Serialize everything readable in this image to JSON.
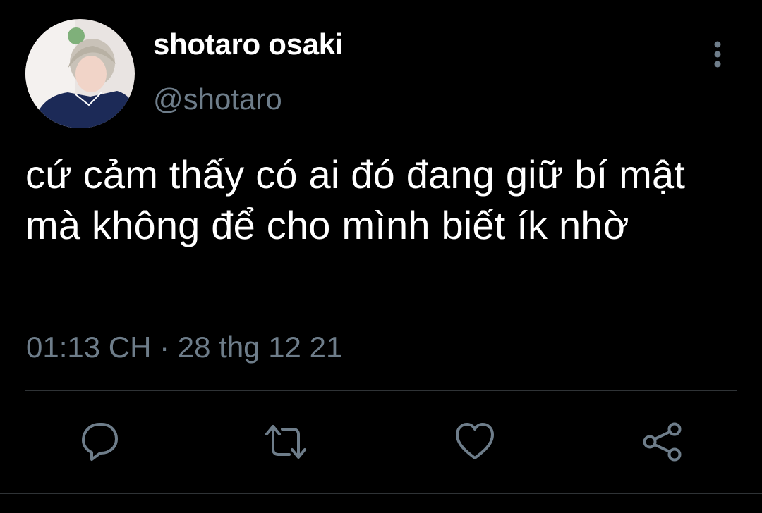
{
  "user": {
    "display_name": "shotaro osaki",
    "handle": "@shotaro"
  },
  "tweet": {
    "text": "cứ cảm thấy có ai đó đang giữ bí mật mà không để cho mình biết ík nhờ",
    "timestamp": "01:13 CH · 28 thg 12 21"
  },
  "icons": {
    "more": "more-vertical-icon",
    "reply": "reply-icon",
    "retweet": "retweet-icon",
    "like": "heart-icon",
    "share": "share-icon"
  },
  "colors": {
    "background": "#000000",
    "primary_text": "#ffffff",
    "secondary_text": "#6e7d8a",
    "divider": "#2f3336"
  }
}
